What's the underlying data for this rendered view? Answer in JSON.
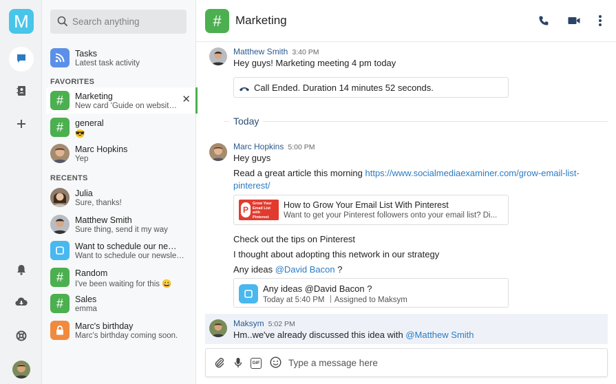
{
  "rail": {
    "logo": "M"
  },
  "search": {
    "placeholder": "Search anything"
  },
  "tasks": {
    "title": "Tasks",
    "subtitle": "Latest task activity"
  },
  "favorites": {
    "label": "FAVORITES",
    "items": [
      {
        "title": "Marketing",
        "subtitle": "New card 'Guide on website o...",
        "icon": "#",
        "active": true
      },
      {
        "title": "general",
        "subtitle": "😎",
        "icon": "#"
      },
      {
        "title": "Marc Hopkins",
        "subtitle": "Yep",
        "icon": "avatar"
      }
    ]
  },
  "recents": {
    "label": "RECENTS",
    "items": [
      {
        "title": "Julia",
        "subtitle": "Sure, thanks!"
      },
      {
        "title": "Matthew Smith",
        "subtitle": "Sure thing, send it my way"
      },
      {
        "title": "Want to schedule our newsl...",
        "subtitle": "Want to schedule our newslet..."
      },
      {
        "title": "Random",
        "subtitle": "I've been waiting for this 😀",
        "icon": "#"
      },
      {
        "title": "Sales",
        "subtitle": "emma",
        "icon": "#"
      },
      {
        "title": "Marc's birthday",
        "subtitle": "Marc's birthday coming soon."
      }
    ]
  },
  "header": {
    "icon": "#",
    "title": "Marketing"
  },
  "messages": {
    "m1": {
      "author": "Matthew Smith",
      "time": "3:40 PM",
      "text": "Hey guys! Marketing meeting 4 pm today",
      "call": "Call Ended. Duration 14 minutes 52 seconds."
    },
    "divider": "Today",
    "m2": {
      "author": "Marc Hopkins",
      "time": "5:00 PM",
      "line1": "Hey guys",
      "line2_prefix": "Read a great article this morning ",
      "link_part1": "https://www.socialmediaexaminer.com/grow-email-list-",
      "link_part2": "pinterest/",
      "preview_title": "How to Grow Your Email List With Pinterest",
      "preview_desc": "Want to get your Pinterest followers onto your email list? Di...",
      "preview_thumb": "Grow Your Email List with Pinterest",
      "line3": "Check out the tips on Pinterest",
      "line4": "I thought about adopting this network in our strategy",
      "line5_prefix": "Any ideas ",
      "line5_mention": "@David Bacon",
      "line5_suffix": " ?",
      "task_title": "Any ideas @David Bacon ?",
      "task_meta_prefix": "Today at ",
      "task_meta_time": "5:40 PM",
      "task_meta_assigned": "Assigned to Maksym"
    },
    "m3": {
      "author": "Maksym",
      "time": "5:02 PM",
      "text_prefix": "Hm..we've already discussed this idea with ",
      "mention": "@Matthew Smith"
    }
  },
  "composer": {
    "placeholder": "Type a message here",
    "gif_label": "GIF"
  },
  "colors": {
    "accent_green": "#4caf50",
    "logo_blue": "#49c5ea",
    "link_blue": "#2b7bc4",
    "task_orange": "#f08a3e"
  }
}
